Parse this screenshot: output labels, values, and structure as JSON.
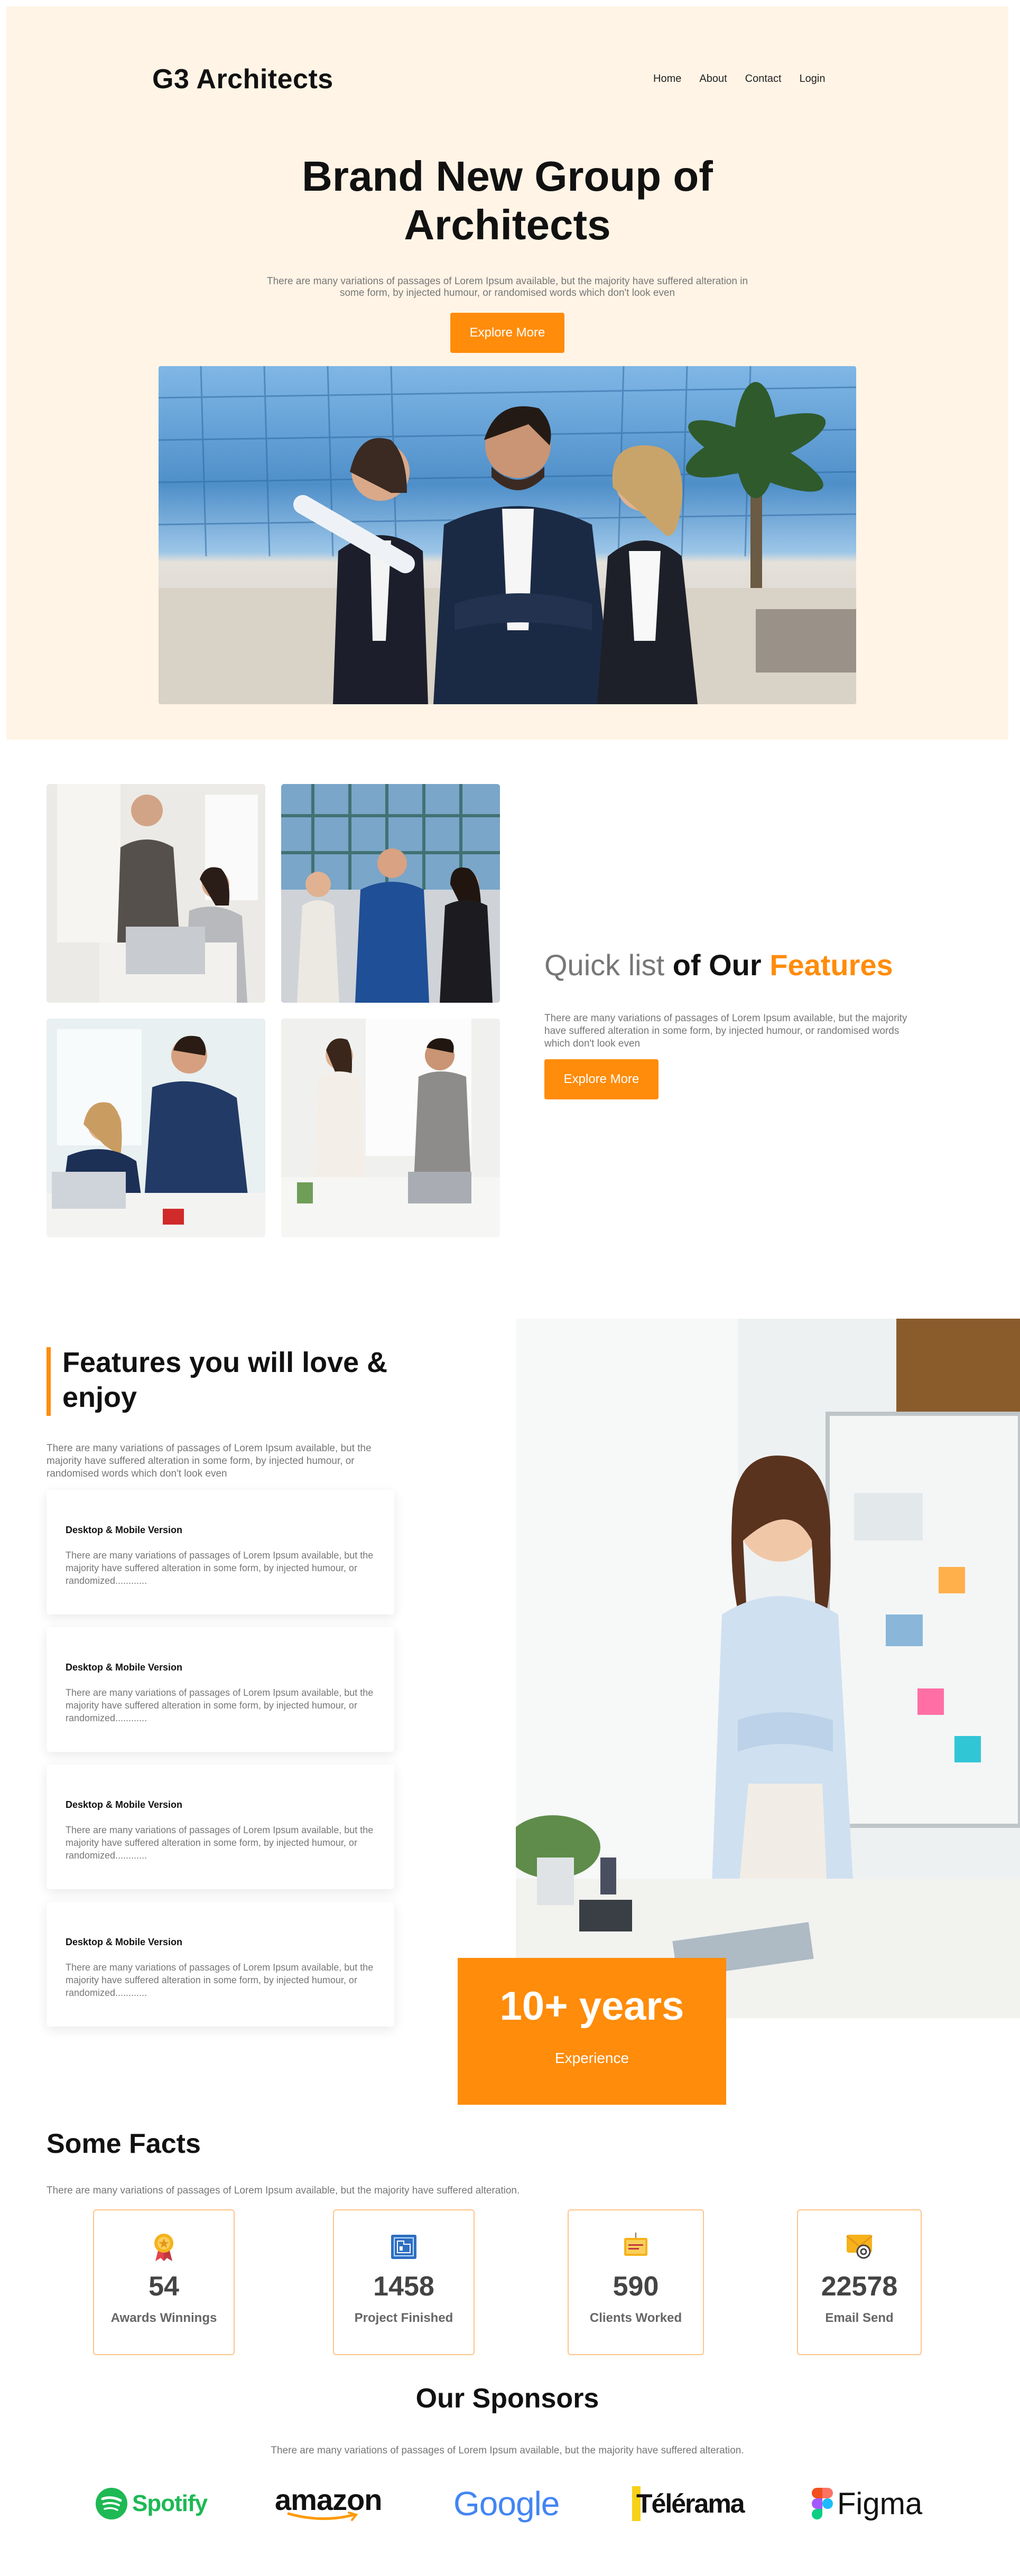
{
  "header": {
    "brand": "G3 Architects",
    "nav": [
      "Home",
      "About",
      "Contact",
      "Login"
    ]
  },
  "hero": {
    "title_line1": "Brand New Group of",
    "title_line2": "Architects",
    "subtitle": "There are many variations of passages of Lorem Ipsum available, but the majority have suffered alteration in some form, by injected humour, or randomised words which don't look even",
    "button": "Explore More"
  },
  "quick": {
    "title_a": "Quick list ",
    "title_b": "of Our ",
    "title_c": "Features",
    "subtitle": "There are many variations of passages of Lorem Ipsum available, but the majority have suffered alteration in some form, by injected humour, or randomised words which don't look even",
    "button": "Explore More"
  },
  "features": {
    "title": "Features you will love & enjoy",
    "subtitle": "There are many variations of passages of Lorem Ipsum available, but the majority have suffered alteration in some form, by injected humour, or randomised words which don't look even",
    "cards": [
      {
        "title": "Desktop & Mobile Version",
        "text": "There are many variations of passages of Lorem Ipsum available, but the majority have suffered alteration in some form, by injected humour, or randomized............"
      },
      {
        "title": "Desktop & Mobile Version",
        "text": "There are many variations of passages of Lorem Ipsum available, but the majority have suffered alteration in some form, by injected humour, or randomized............"
      },
      {
        "title": "Desktop & Mobile Version",
        "text": "There are many variations of passages of Lorem Ipsum available, but the majority have suffered alteration in some form, by injected humour, or randomized............"
      },
      {
        "title": "Desktop & Mobile Version",
        "text": "There are many variations of passages of Lorem Ipsum available, but the majority have suffered alteration in some form, by injected humour, or randomized............"
      }
    ],
    "experience_number": "10+ years",
    "experience_label": "Experience"
  },
  "facts": {
    "title": "Some Facts",
    "subtitle": "There are many variations of passages of Lorem Ipsum available, but the majority have suffered alteration.",
    "items": [
      {
        "icon": "award-medal-icon",
        "number": "54",
        "label": "Awards Winnings"
      },
      {
        "icon": "blueprint-icon",
        "number": "1458",
        "label": "Project Finished"
      },
      {
        "icon": "clients-sign-icon",
        "number": "590",
        "label": "Clients Worked"
      },
      {
        "icon": "email-icon",
        "number": "22578",
        "label": "Email Send"
      }
    ]
  },
  "sponsors": {
    "title": "Our Sponsors",
    "subtitle": "There are many variations of passages of Lorem Ipsum available, but the majority have suffered alteration.",
    "logos": [
      "Spotify",
      "amazon",
      "Google",
      "Télérama",
      "Figma"
    ]
  },
  "colors": {
    "accent": "#FF8C0A",
    "hero_bg": "#FFF4E6",
    "muted_text": "#777777"
  }
}
